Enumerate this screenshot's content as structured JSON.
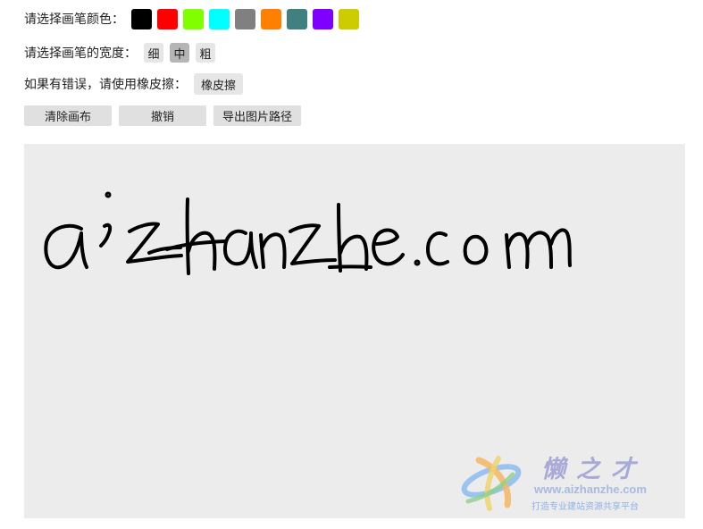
{
  "color_row": {
    "label": "请选择画笔颜色：",
    "swatches": [
      {
        "name": "black",
        "color": "#000000"
      },
      {
        "name": "red",
        "color": "#ff0000"
      },
      {
        "name": "lime",
        "color": "#80ff00"
      },
      {
        "name": "cyan",
        "color": "#00ffff"
      },
      {
        "name": "gray",
        "color": "#808080"
      },
      {
        "name": "orange",
        "color": "#ff8000"
      },
      {
        "name": "teal",
        "color": "#408080"
      },
      {
        "name": "purple",
        "color": "#8000ff"
      },
      {
        "name": "olive-yellow",
        "color": "#cccc00"
      }
    ]
  },
  "width_row": {
    "label": "请选择画笔的宽度：",
    "thin": "细",
    "medium": "中",
    "thick": "粗",
    "selected": "中"
  },
  "eraser_row": {
    "label": "如果有错误，请使用橡皮擦：",
    "button": "橡皮擦"
  },
  "actions": {
    "clear": "清除画布",
    "undo": "撤销",
    "export": "导出图片路径"
  },
  "canvas": {
    "background": "#ececec",
    "handwriting": "aizhanzhe.com",
    "stroke_color": "#000000"
  },
  "watermark": {
    "title": "懒之才",
    "url": "www.aizhanzhe.com",
    "subtitle": "打造专业建站资源共享平台"
  }
}
